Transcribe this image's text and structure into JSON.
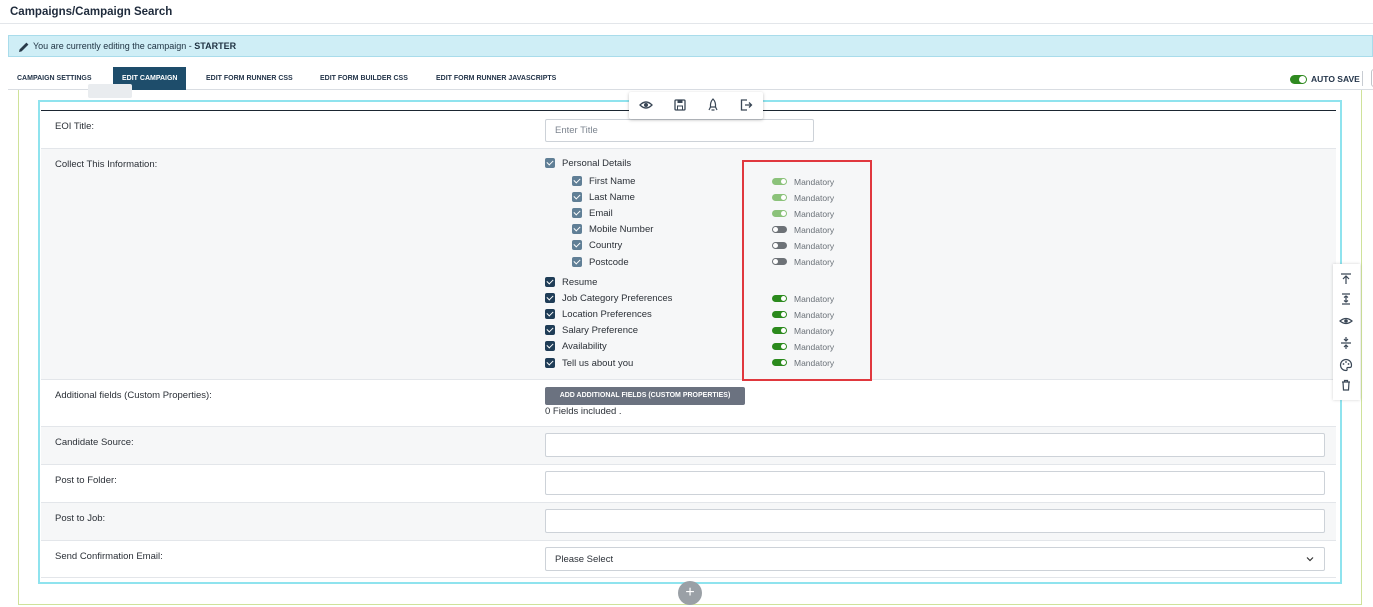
{
  "header": {
    "title": "Campaigns/Campaign Search"
  },
  "notice": {
    "prefix": "You are currently editing the campaign - ",
    "campaign_name": "STARTER"
  },
  "tabs": [
    {
      "label": "CAMPAIGN SETTINGS",
      "active": false
    },
    {
      "label": "EDIT CAMPAIGN",
      "active": true
    },
    {
      "label": "EDIT FORM RUNNER CSS",
      "active": false
    },
    {
      "label": "EDIT FORM BUILDER CSS",
      "active": false
    },
    {
      "label": "EDIT FORM RUNNER JAVASCRIPTS",
      "active": false
    }
  ],
  "autosave": {
    "label": "AUTO SAVE",
    "on": true
  },
  "floating_toolbar": {
    "icons": [
      "eye-icon",
      "save-icon",
      "rocket-icon",
      "exit-icon"
    ]
  },
  "form": {
    "eoi_title": {
      "label": "EOI Title:",
      "placeholder": "Enter Title",
      "value": ""
    },
    "collect": {
      "label": "Collect This Information:",
      "groups": [
        {
          "label": "Personal Details",
          "checked": true,
          "children": [
            {
              "label": "First Name",
              "checked": true,
              "mandatory_label": "Mandatory",
              "mandatory": true
            },
            {
              "label": "Last Name",
              "checked": true,
              "mandatory_label": "Mandatory",
              "mandatory": true
            },
            {
              "label": "Email",
              "checked": true,
              "mandatory_label": "Mandatory",
              "mandatory": true
            },
            {
              "label": "Mobile Number",
              "checked": true,
              "mandatory_label": "Mandatory",
              "mandatory": false
            },
            {
              "label": "Country",
              "checked": true,
              "mandatory_label": "Mandatory",
              "mandatory": false
            },
            {
              "label": "Postcode",
              "checked": true,
              "mandatory_label": "Mandatory",
              "mandatory": false
            }
          ]
        }
      ],
      "items": [
        {
          "label": "Resume",
          "checked": true
        },
        {
          "label": "Job Category Preferences",
          "checked": true,
          "mandatory_label": "Mandatory",
          "mandatory": true
        },
        {
          "label": "Location Preferences",
          "checked": true,
          "mandatory_label": "Mandatory",
          "mandatory": true
        },
        {
          "label": "Salary Preference",
          "checked": true,
          "mandatory_label": "Mandatory",
          "mandatory": true
        },
        {
          "label": "Availability",
          "checked": true,
          "mandatory_label": "Mandatory",
          "mandatory": true
        },
        {
          "label": "Tell us about you",
          "checked": true,
          "mandatory_label": "Mandatory",
          "mandatory": true
        }
      ]
    },
    "additional_fields": {
      "label": "Additional fields (Custom Properties):",
      "button_label": "ADD ADDITIONAL FIELDS (CUSTOM PROPERTIES)",
      "count_text": "0 Fields included ."
    },
    "candidate_source": {
      "label": "Candidate Source:",
      "value": ""
    },
    "post_to_folder": {
      "label": "Post to Folder:",
      "value": ""
    },
    "post_to_job": {
      "label": "Post to Job:",
      "value": ""
    },
    "send_confirmation": {
      "label": "Send Confirmation Email:",
      "selected": "Please Select"
    }
  },
  "side_toolbar": {
    "icons": [
      "move-top-icon",
      "align-middle-icon",
      "eye-icon",
      "split-icon",
      "palette-icon",
      "trash-icon"
    ]
  },
  "colors": {
    "primary_tab": "#1e4d6b",
    "toggle_on": "#2b8a1d",
    "toggle_on_light": "#8bc27a",
    "toggle_off": "#6d7277",
    "highlight": "#e0383e",
    "notice_bg": "#cfeef6"
  }
}
